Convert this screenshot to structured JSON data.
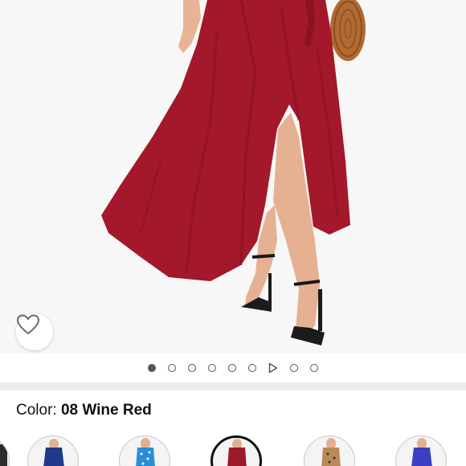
{
  "hero": {
    "image_alt": "Woman wearing wine red ruffle hem maxi wrap dress with rattan bag and black strappy heels",
    "favorite_icon": "heart-outline-icon"
  },
  "carousel": {
    "active_index": 0,
    "items": [
      "image",
      "image",
      "image",
      "image",
      "image",
      "image",
      "video",
      "image",
      "image"
    ]
  },
  "color": {
    "label": "Color:",
    "value": "08 Wine Red"
  },
  "swatches": [
    {
      "name": "navy-blue",
      "color": "#1f3a8a",
      "selected": false
    },
    {
      "name": "blue-polka-dot",
      "color": "#2a8ed6",
      "selected": false
    },
    {
      "name": "wine-red",
      "color": "#9b1b2a",
      "selected": true
    },
    {
      "name": "leopard",
      "color": "#b88a5a",
      "selected": false
    },
    {
      "name": "royal-blue",
      "color": "#3b3fc4",
      "selected": false
    }
  ],
  "colors": {
    "dress": "#a3182a",
    "dress_shadow": "#7e1020",
    "skin": "#e9b79a",
    "divider": "#eaeded"
  }
}
